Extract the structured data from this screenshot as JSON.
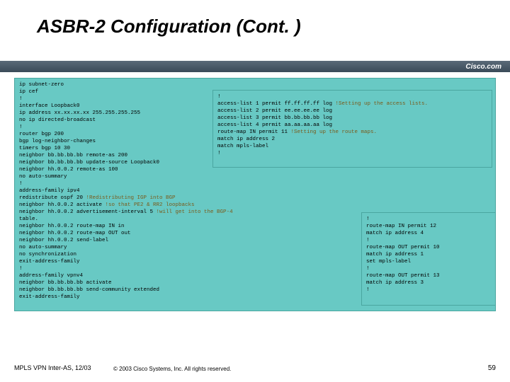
{
  "title": "ASBR-2 Configuration (Cont. )",
  "cisco_label": "Cisco.com",
  "footer": {
    "left": "MPLS VPN Inter-AS,\n12/03",
    "mid": "© 2003 Cisco Systems, Inc. All rights reserved.",
    "page": "59"
  },
  "box1": {
    "lines": [
      {
        "t": "ip subnet-zero",
        "c": ""
      },
      {
        "t": "ip cef",
        "c": ""
      },
      {
        "t": "!",
        "c": ""
      },
      {
        "t": "interface Loopback0",
        "c": ""
      },
      {
        "t": "ip address xx.xx.xx.xx 255.255.255.255",
        "c": ""
      },
      {
        "t": "no ip directed-broadcast",
        "c": ""
      },
      {
        "t": "!",
        "c": ""
      },
      {
        "t": "router bgp 200",
        "c": ""
      },
      {
        "t": "bgp log-neighbor-changes",
        "c": ""
      },
      {
        "t": "timers bgp 10 30",
        "c": ""
      },
      {
        "t": "neighbor bb.bb.bb.bb remote-as 200",
        "c": ""
      },
      {
        "t": "neighbor bb.bb.bb.bb update-source Loopback0",
        "c": ""
      },
      {
        "t": "neighbor hh.0.0.2 remote-as 100",
        "c": ""
      },
      {
        "t": "no auto-summary",
        "c": ""
      },
      {
        "t": "!",
        "c": ""
      },
      {
        "t": "address-family ipv4",
        "c": ""
      },
      {
        "t": "redistribute ospf 20 ",
        "c": "!Redistributing IGP into BGP"
      },
      {
        "t": "neighbor hh.0.0.2 activate ",
        "c": "!so that PE2 & RR2 loopbacks"
      },
      {
        "t": "neighbor hh.0.0.2 advertisement-interval 5 ",
        "c": "!will get into the BGP-4"
      },
      {
        "t": "table.",
        "c": ""
      },
      {
        "t": "neighbor hh.0.0.2 route-map IN in",
        "c": ""
      },
      {
        "t": "neighbor hh.0.0.2 route-map OUT out",
        "c": ""
      },
      {
        "t": "neighbor hh.0.0.2 send-label",
        "c": ""
      },
      {
        "t": "no auto-summary",
        "c": ""
      },
      {
        "t": "no synchronization",
        "c": ""
      },
      {
        "t": "exit-address-family",
        "c": ""
      },
      {
        "t": "!",
        "c": ""
      },
      {
        "t": "address-family vpnv4",
        "c": ""
      },
      {
        "t": "neighbor bb.bb.bb.bb activate",
        "c": ""
      },
      {
        "t": "neighbor bb.bb.bb.bb send-community extended",
        "c": ""
      },
      {
        "t": "exit-address-family",
        "c": ""
      }
    ]
  },
  "box2": {
    "lines": [
      {
        "t": "!",
        "c": ""
      },
      {
        "t": "access-list 1 permit ff.ff.ff.ff log ",
        "c": "!Setting up the access lists."
      },
      {
        "t": "access-list 2 permit ee.ee.ee.ee log",
        "c": ""
      },
      {
        "t": "access-list 3 permit bb.bb.bb.bb log",
        "c": ""
      },
      {
        "t": "access-list 4 permit aa.aa.aa.aa log",
        "c": ""
      },
      {
        "t": "route-map IN permit 11 ",
        "c": "!Setting up the route maps."
      },
      {
        "t": "match ip address 2",
        "c": ""
      },
      {
        "t": "match mpls-label",
        "c": ""
      },
      {
        "t": "!",
        "c": ""
      }
    ]
  },
  "box3": {
    "lines": [
      {
        "t": "!",
        "c": ""
      },
      {
        "t": "route-map IN permit 12",
        "c": ""
      },
      {
        "t": "match ip address 4",
        "c": ""
      },
      {
        "t": "!",
        "c": ""
      },
      {
        "t": "route-map OUT permit 10",
        "c": ""
      },
      {
        "t": "match ip address 1",
        "c": ""
      },
      {
        "t": "set mpls-label",
        "c": ""
      },
      {
        "t": "!",
        "c": ""
      },
      {
        "t": "route-map OUT permit 13",
        "c": ""
      },
      {
        "t": "match ip address 3",
        "c": ""
      },
      {
        "t": "!",
        "c": ""
      }
    ]
  }
}
